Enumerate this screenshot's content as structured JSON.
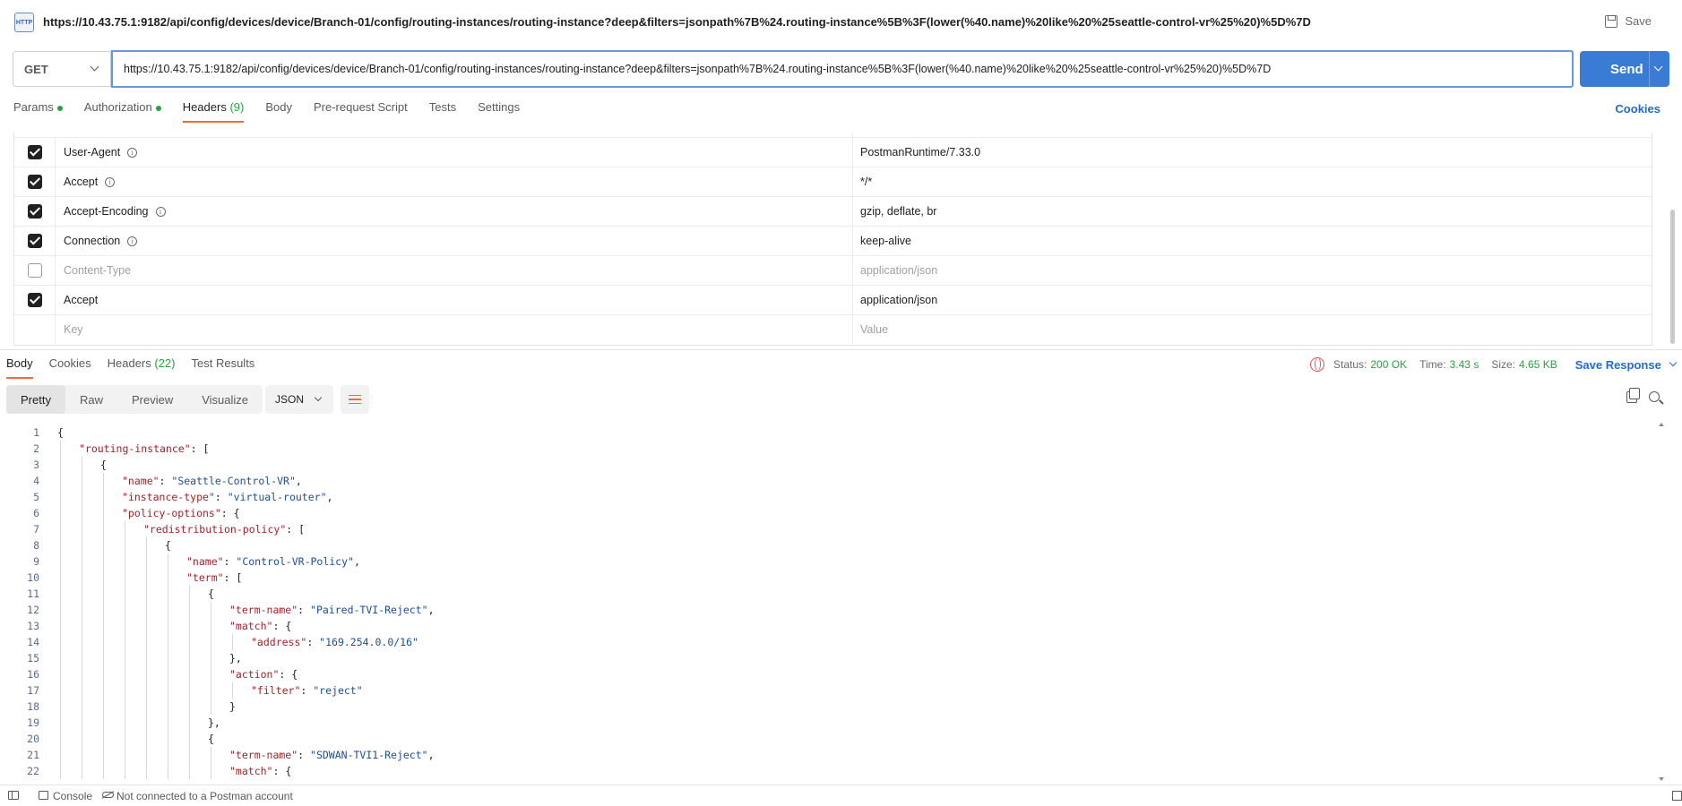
{
  "titlebar": {
    "icon_text": "HTTP",
    "title": "https://10.43.75.1:9182/api/config/devices/device/Branch-01/config/routing-instances/routing-instance?deep&filters=jsonpath%7B%24.routing-instance%5B%3F(lower(%40.name)%20like%20%25seattle-control-vr%25%20)%5D%7D",
    "save_label": "Save"
  },
  "request": {
    "method": "GET",
    "url": "https://10.43.75.1:9182/api/config/devices/device/Branch-01/config/routing-instances/routing-instance?deep&filters=jsonpath%7B%24.routing-instance%5B%3F(lower(%40.name)%20like%20%25seattle-control-vr%25%20)%5D%7D",
    "send_label": "Send"
  },
  "request_tabs": [
    {
      "label": "Params",
      "dot": true
    },
    {
      "label": "Authorization",
      "dot": true
    },
    {
      "label": "Headers",
      "count": "(9)",
      "active": true
    },
    {
      "label": "Body"
    },
    {
      "label": "Pre-request Script"
    },
    {
      "label": "Tests"
    },
    {
      "label": "Settings"
    }
  ],
  "cookies_label": "Cookies",
  "headers": [
    {
      "key": "User-Agent",
      "value": "PostmanRuntime/7.33.0",
      "checked": true,
      "info": true
    },
    {
      "key": "Accept",
      "value": "*/*",
      "checked": true,
      "info": true
    },
    {
      "key": "Accept-Encoding",
      "value": "gzip, deflate, br",
      "checked": true,
      "info": true
    },
    {
      "key": "Connection",
      "value": "keep-alive",
      "checked": true,
      "info": true
    },
    {
      "key": "Content-Type",
      "value": "application/json",
      "checked": false
    },
    {
      "key": "Accept",
      "value": "application/json",
      "checked": true
    }
  ],
  "headers_placeholder": {
    "key": "Key",
    "value": "Value"
  },
  "response_tabs": [
    {
      "label": "Body",
      "active": true
    },
    {
      "label": "Cookies"
    },
    {
      "label": "Headers",
      "count": "(22)"
    },
    {
      "label": "Test Results"
    }
  ],
  "status": {
    "status_label": "Status:",
    "status_value": "200 OK",
    "time_label": "Time:",
    "time_value": "3.43 s",
    "size_label": "Size:",
    "size_value": "4.65 KB",
    "save_response_label": "Save Response"
  },
  "view_modes": [
    "Pretty",
    "Raw",
    "Preview",
    "Visualize"
  ],
  "format": "JSON",
  "code_lines": [
    {
      "n": "1",
      "indent": 0,
      "tokens": [
        [
          "p",
          "{"
        ]
      ]
    },
    {
      "n": "2",
      "indent": 1,
      "tokens": [
        [
          "k",
          "\"routing-instance\""
        ],
        [
          "p",
          ": ["
        ]
      ]
    },
    {
      "n": "3",
      "indent": 2,
      "tokens": [
        [
          "p",
          "{"
        ]
      ]
    },
    {
      "n": "4",
      "indent": 3,
      "tokens": [
        [
          "k",
          "\"name\""
        ],
        [
          "p",
          ": "
        ],
        [
          "s",
          "\"Seattle-Control-VR\""
        ],
        [
          "p",
          ","
        ]
      ]
    },
    {
      "n": "5",
      "indent": 3,
      "tokens": [
        [
          "k",
          "\"instance-type\""
        ],
        [
          "p",
          ": "
        ],
        [
          "s",
          "\"virtual-router\""
        ],
        [
          "p",
          ","
        ]
      ]
    },
    {
      "n": "6",
      "indent": 3,
      "tokens": [
        [
          "k",
          "\"policy-options\""
        ],
        [
          "p",
          ": {"
        ]
      ]
    },
    {
      "n": "7",
      "indent": 4,
      "tokens": [
        [
          "k",
          "\"redistribution-policy\""
        ],
        [
          "p",
          ": ["
        ]
      ]
    },
    {
      "n": "8",
      "indent": 5,
      "tokens": [
        [
          "p",
          "{"
        ]
      ]
    },
    {
      "n": "9",
      "indent": 6,
      "tokens": [
        [
          "k",
          "\"name\""
        ],
        [
          "p",
          ": "
        ],
        [
          "s",
          "\"Control-VR-Policy\""
        ],
        [
          "p",
          ","
        ]
      ]
    },
    {
      "n": "10",
      "indent": 6,
      "tokens": [
        [
          "k",
          "\"term\""
        ],
        [
          "p",
          ": ["
        ]
      ]
    },
    {
      "n": "11",
      "indent": 7,
      "tokens": [
        [
          "p",
          "{"
        ]
      ]
    },
    {
      "n": "12",
      "indent": 8,
      "tokens": [
        [
          "k",
          "\"term-name\""
        ],
        [
          "p",
          ": "
        ],
        [
          "s",
          "\"Paired-TVI-Reject\""
        ],
        [
          "p",
          ","
        ]
      ]
    },
    {
      "n": "13",
      "indent": 8,
      "tokens": [
        [
          "k",
          "\"match\""
        ],
        [
          "p",
          ": {"
        ]
      ]
    },
    {
      "n": "14",
      "indent": 9,
      "tokens": [
        [
          "k",
          "\"address\""
        ],
        [
          "p",
          ": "
        ],
        [
          "s",
          "\"169.254.0.0/16\""
        ]
      ]
    },
    {
      "n": "15",
      "indent": 8,
      "tokens": [
        [
          "p",
          "},"
        ]
      ]
    },
    {
      "n": "16",
      "indent": 8,
      "tokens": [
        [
          "k",
          "\"action\""
        ],
        [
          "p",
          ": {"
        ]
      ]
    },
    {
      "n": "17",
      "indent": 9,
      "tokens": [
        [
          "k",
          "\"filter\""
        ],
        [
          "p",
          ": "
        ],
        [
          "s",
          "\"reject\""
        ]
      ]
    },
    {
      "n": "18",
      "indent": 8,
      "tokens": [
        [
          "p",
          "}"
        ]
      ]
    },
    {
      "n": "19",
      "indent": 7,
      "tokens": [
        [
          "p",
          "},"
        ]
      ]
    },
    {
      "n": "20",
      "indent": 7,
      "tokens": [
        [
          "p",
          "{"
        ]
      ]
    },
    {
      "n": "21",
      "indent": 8,
      "tokens": [
        [
          "k",
          "\"term-name\""
        ],
        [
          "p",
          ": "
        ],
        [
          "s",
          "\"SDWAN-TVI1-Reject\""
        ],
        [
          "p",
          ","
        ]
      ]
    },
    {
      "n": "22",
      "indent": 8,
      "tokens": [
        [
          "k",
          "\"match\""
        ],
        [
          "p",
          ": {"
        ]
      ]
    }
  ],
  "footer": {
    "console_label": "Console",
    "account_label": "Not connected to a Postman account"
  }
}
